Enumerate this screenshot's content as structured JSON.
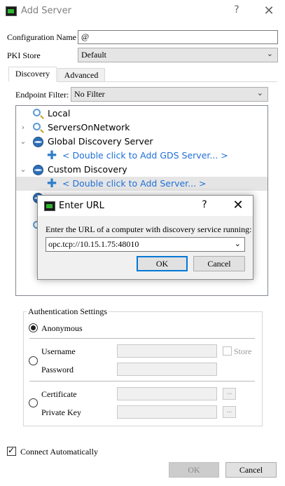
{
  "window": {
    "title": "Add Server",
    "help": "?",
    "close": "✕"
  },
  "config": {
    "label": "Configuration Name",
    "value": "@"
  },
  "pki": {
    "label": "PKI Store",
    "value": "Default"
  },
  "tabs": [
    {
      "label": "Discovery"
    },
    {
      "label": "Advanced"
    }
  ],
  "filter": {
    "label": "Endpoint Filter:",
    "value": "No Filter"
  },
  "tree": {
    "local": "Local",
    "servers_on_network": "ServersOnNetwork",
    "global_discovery": "Global Discovery Server",
    "add_gds": "< Double click to Add GDS Server... >",
    "custom_discovery": "Custom Discovery",
    "add_server": "< Double click to Add Server... >"
  },
  "auth": {
    "legend": "Authentication Settings",
    "anonymous": "Anonymous",
    "username": "Username",
    "password": "Password",
    "store": "Store",
    "certificate": "Certificate",
    "private_key": "Private Key",
    "dots": "..."
  },
  "connect_automatically": "Connect Automatically",
  "buttons": {
    "ok": "OK",
    "cancel": "Cancel"
  },
  "modal": {
    "title": "Enter URL",
    "help": "?",
    "close": "✕",
    "prompt": "Enter the URL of a computer with discovery service running:",
    "url_value": "opc.tcp://10.15.1.75:48010",
    "ok": "OK",
    "cancel": "Cancel"
  }
}
